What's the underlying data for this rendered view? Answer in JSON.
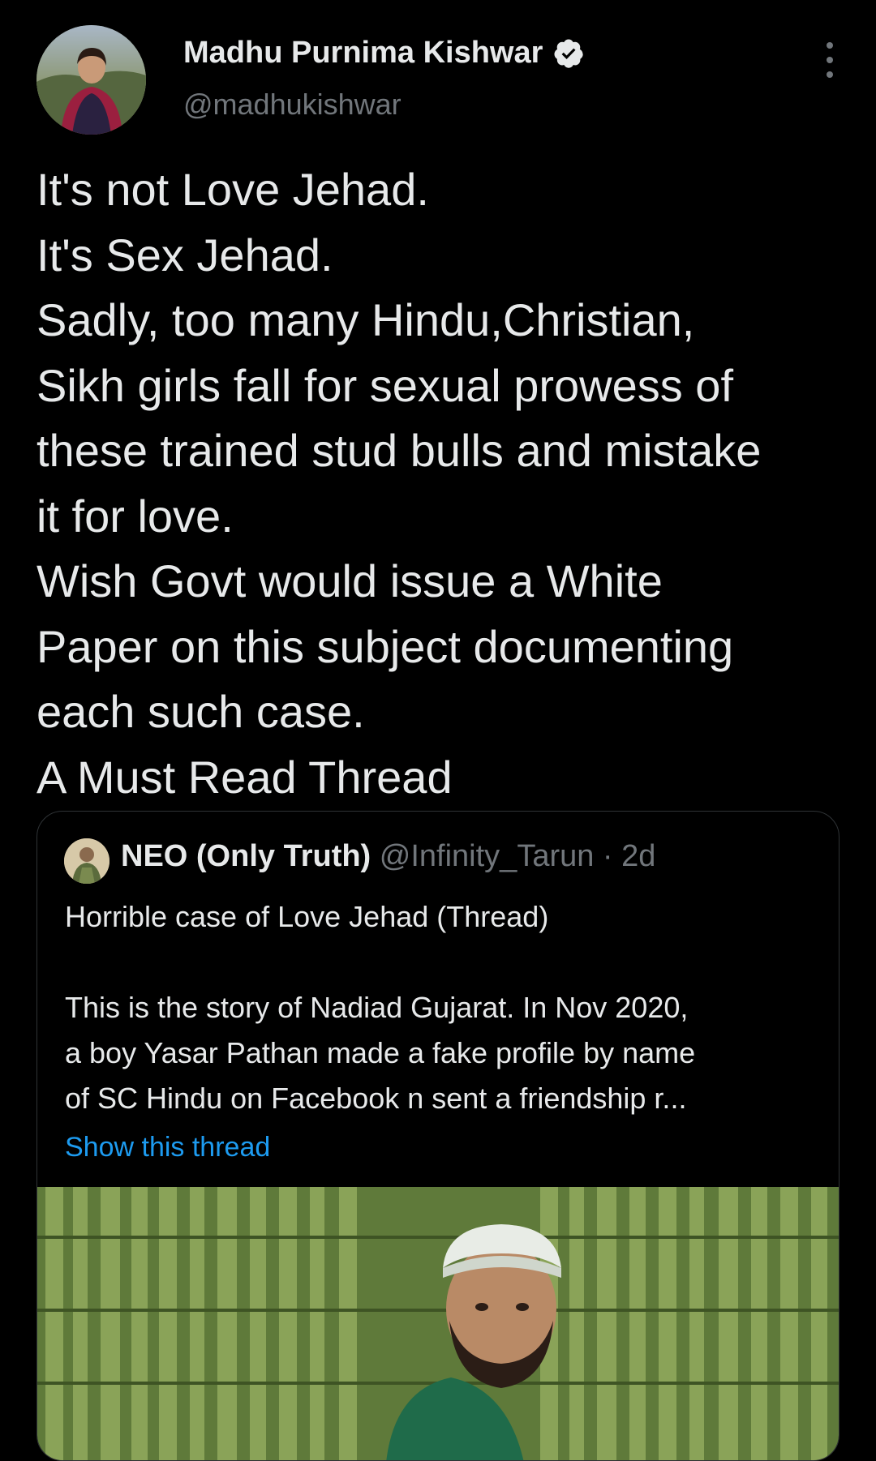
{
  "author": {
    "name": "Madhu Purnima Kishwar",
    "handle": "@madhukishwar"
  },
  "tweet": {
    "lines": [
      "It's not Love Jehad.",
      "It's Sex Jehad.",
      "Sadly, too many Hindu,Christian,",
      "Sikh girls fall for sexual prowess of",
      "these trained stud bulls and mistake",
      "it for love.",
      "Wish Govt would issue a White",
      "Paper on this subject documenting",
      "each such case.",
      "A Must Read Thread"
    ]
  },
  "quoted": {
    "name": "NEO (Only Truth)",
    "handle_time": "@Infinity_Tarun · 2d",
    "text_lines": [
      "Horrible case of Love Jehad (Thread)",
      "",
      "This is the story of Nadiad Gujarat. In Nov 2020,",
      "a boy Yasar Pathan made a fake profile by name",
      "of SC Hindu on Facebook n sent a friendship r..."
    ],
    "show_thread": "Show this thread"
  },
  "colors": {
    "background": "#000000",
    "text": "#e7e9ea",
    "secondary": "#71767b",
    "link": "#1d9bf0",
    "border": "#2f3336"
  },
  "icons": [
    "verified-badge-icon",
    "more-options-icon"
  ]
}
